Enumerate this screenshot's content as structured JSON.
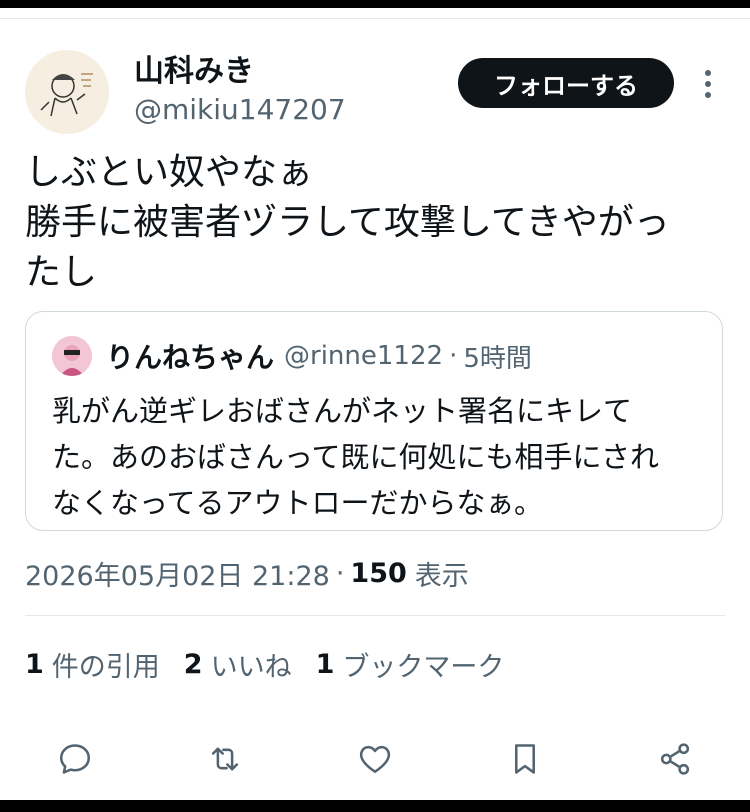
{
  "tweet": {
    "author": {
      "display_name": "山科みき",
      "handle": "@mikiu147207"
    },
    "follow_label": "フォローする",
    "text": "しぶとい奴やなぁ\n勝手に被害者ヅラして攻撃してきやがっ\nたし",
    "quoted": {
      "display_name": "りんねちゃん",
      "handle": "@rinne1122",
      "separator": "·",
      "time": "5時間",
      "text": "乳がん逆ギレおばさんがネット署名にキレて\nた。あのおばさんって既に何処にも相手にされ\nなくなってるアウトローだからなぁ。"
    },
    "timestamp": "2026年05月02日 21:28",
    "meta_separator": "·",
    "views_count": "150",
    "views_label": "表示",
    "stats": [
      {
        "count": "1",
        "label": "件の引用"
      },
      {
        "count": "2",
        "label": "いいね"
      },
      {
        "count": "1",
        "label": "ブックマーク"
      }
    ]
  },
  "icons": {
    "more": "more-vertical-icon",
    "reply": "reply-icon",
    "retweet": "retweet-icon",
    "like": "heart-icon",
    "bookmark": "bookmark-icon",
    "share": "share-icon"
  },
  "colors": {
    "text": "#0f1419",
    "muted": "#536471",
    "border": "#cfd9de",
    "button_bg": "#0f1419"
  }
}
